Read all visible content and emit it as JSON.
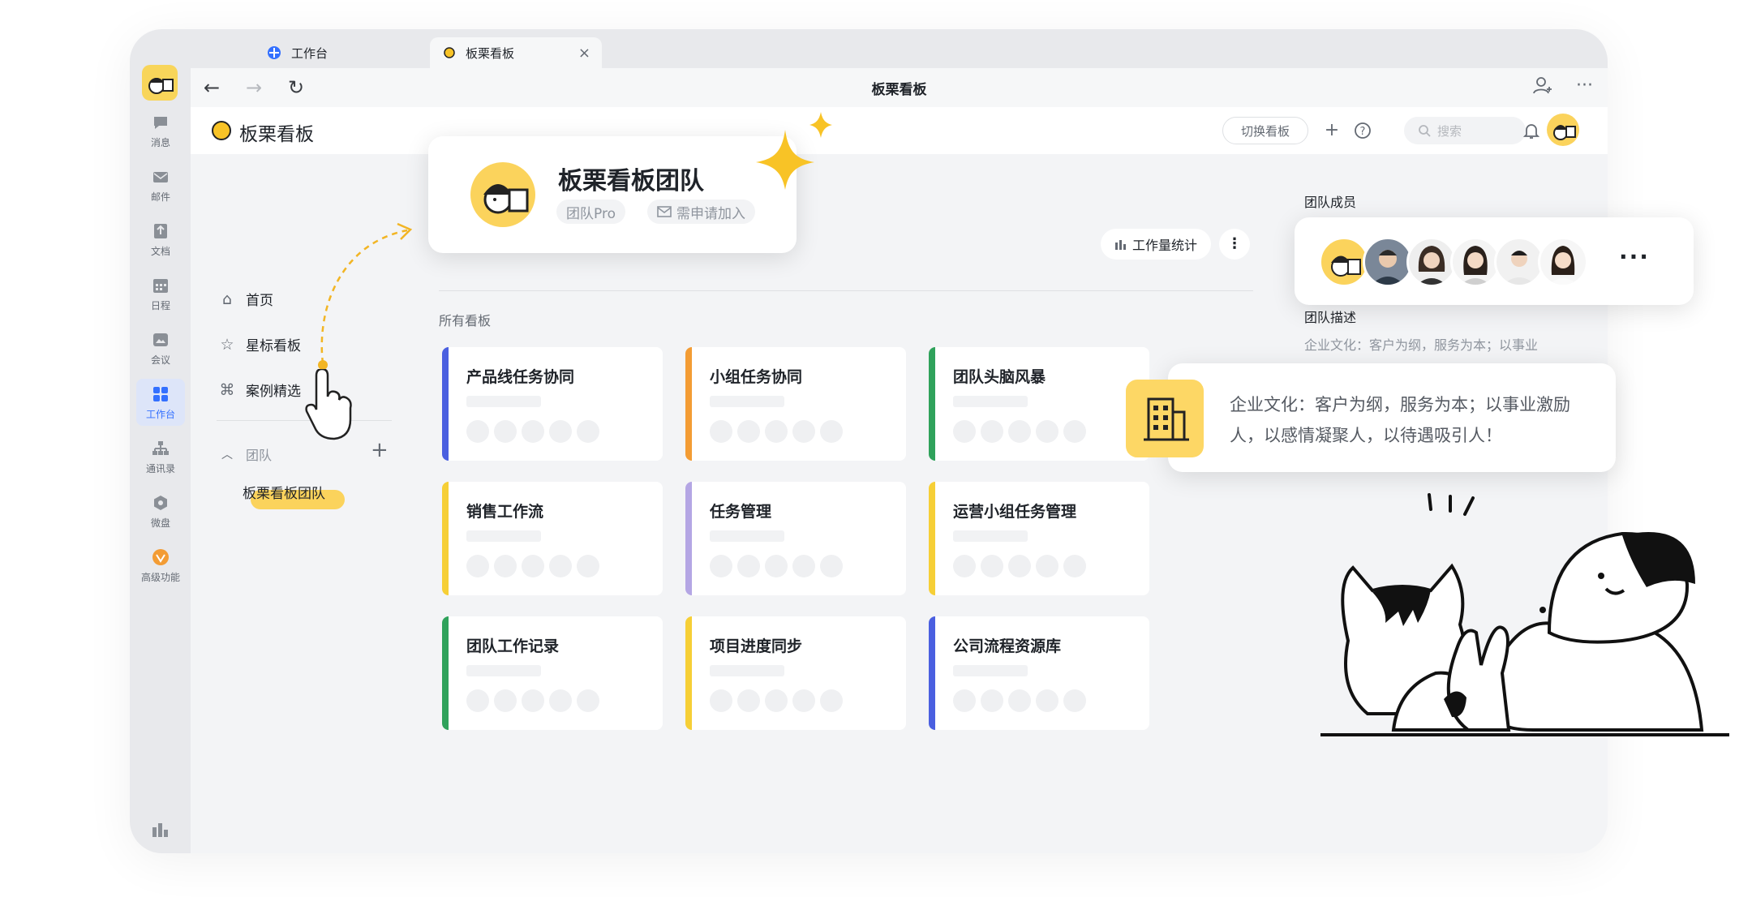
{
  "browser": {
    "tabs": [
      {
        "label": "工作台",
        "icon": "workspace-grid-icon"
      },
      {
        "label": "板栗看板",
        "icon": "app-logo-icon"
      }
    ],
    "title": "板栗看板"
  },
  "rail": {
    "items": [
      {
        "label": "消息",
        "icon": "chat-bubble-icon"
      },
      {
        "label": "邮件",
        "icon": "mail-icon"
      },
      {
        "label": "文档",
        "icon": "document-icon"
      },
      {
        "label": "日程",
        "icon": "calendar-icon"
      },
      {
        "label": "会议",
        "icon": "meeting-icon"
      },
      {
        "label": "工作台",
        "icon": "workspace-grid-icon"
      },
      {
        "label": "通讯录",
        "icon": "org-chart-icon"
      },
      {
        "label": "微盘",
        "icon": "cloud-drive-icon"
      },
      {
        "label": "高级功能",
        "icon": "premium-badge-icon"
      }
    ]
  },
  "app": {
    "name": "板栗看板",
    "switch_board": "切换看板",
    "search_placeholder": "搜索"
  },
  "sidebar": {
    "home": "首页",
    "starred": "星标看板",
    "cases": "案例精选",
    "team_section": "团队",
    "team_name": "板栗看板团队"
  },
  "team_card": {
    "name": "板栗看板团队",
    "plan": "团队Pro",
    "join": "需申请加入"
  },
  "toolbar": {
    "workload": "工作量统计"
  },
  "main": {
    "all_boards_label": "所有看板",
    "boards": [
      {
        "title": "产品线任务协同",
        "color": "#4a5fe0"
      },
      {
        "title": "小组任务协同",
        "color": "#f39c34"
      },
      {
        "title": "团队头脑风暴",
        "color": "#2fa25b"
      },
      {
        "title": "销售工作流",
        "color": "#f6cf36"
      },
      {
        "title": "任务管理",
        "color": "#b4a6e4"
      },
      {
        "title": "运营小组任务管理",
        "color": "#f6cf36"
      },
      {
        "title": "团队工作记录",
        "color": "#2fa25b"
      },
      {
        "title": "项目进度同步",
        "color": "#f6cf36"
      },
      {
        "title": "公司流程资源库",
        "color": "#4a5fe0"
      }
    ]
  },
  "right_panel": {
    "members_label": "团队成员",
    "more": "···",
    "desc_label": "团队描述",
    "desc_preview": "企业文化：客户为纲，服务为本；以事业",
    "description": "企业文化：客户为纲，服务为本；以事业激励人，以感情凝聚人，以待遇吸引人！"
  },
  "colors": {
    "accent": "#3370ff",
    "brand_yellow": "#f8c326",
    "background": "#f3f4f6"
  }
}
